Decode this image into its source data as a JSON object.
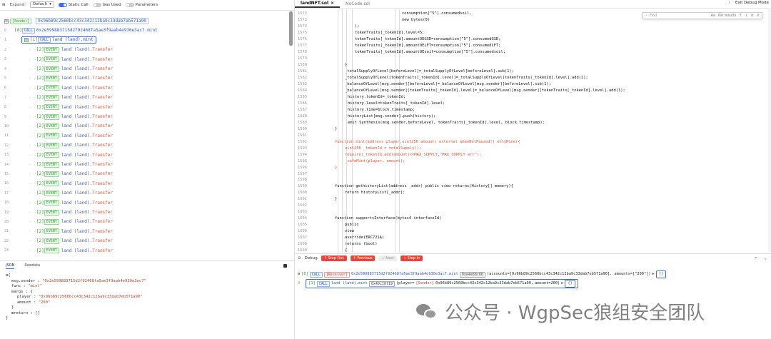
{
  "toolbar": {
    "expand_label": "Expand:",
    "expand_value": "Default",
    "static_call": "Static Call",
    "gas_used": "Gas Used",
    "parameters": "Parameters"
  },
  "trace": {
    "sender_chip": "[Sender]",
    "sender_addr": "0x96b89c2560bcc43c342c12ba9c33dab7eb571a90",
    "root_level": "[0]",
    "root_chip": "CALL",
    "root_addr": "0x2e599883715d2f92468fa5ae3f9aab4e930e3ac7.mint",
    "mint_level": "[1]",
    "mint_chip": "CALL",
    "mint_label": "land (land).mint",
    "event_level": "[2]",
    "event_chip": "EVENT",
    "event_name": "land (land).",
    "event_fn": "Transfer",
    "line_numbers": [
      "0",
      "1",
      "2",
      "3",
      "4",
      "5",
      "6",
      "7",
      "8",
      "9",
      "10",
      "11",
      "12",
      "13",
      "14",
      "15",
      "16",
      "17",
      "18",
      "19",
      "20",
      "21",
      "22",
      "23"
    ]
  },
  "bottom_left": {
    "tab_json": "JSON",
    "tab_raw": "Rawdata",
    "msg_sender_key": "msg.sender :",
    "msg_sender_val": "\"0x2e599883715d2f92468fa5ae3f9aab4e930e3ac7\"",
    "func_key": "func :",
    "func_val": "\"mint\"",
    "args_key": "args : {",
    "player_key": "player :",
    "player_val": "\"0x96b89c2560bcc43c342c12ba9c33dab7eb571a90\"",
    "amount_key": "amount :",
    "amount_val": "\"200\"",
    "close_args": "}",
    "return_key": "return :",
    "return_val": "[]",
    "open_brace": "{",
    "close_brace": "}"
  },
  "editor": {
    "tab_active": "landNFT.sol",
    "tab_other": "NoCode.sol",
    "exit_debug": "Exit Debug Mode",
    "find_placeholder": "Find",
    "find_results": "No results",
    "lines": [
      {
        "n": "1572",
        "t": "consumption[\"5\"].consumedsoil,"
      },
      {
        "n": "1573",
        "t": "new bytes(0)"
      },
      {
        "n": "1574",
        "t": ");"
      },
      {
        "n": "1575",
        "t": "tokenTraits[_tokenId].level=5;"
      },
      {
        "n": "1576",
        "t": "tokenTraits[_tokenId].amountOEGSD=consumption[\"5\"].consumedGSD;"
      },
      {
        "n": "1577",
        "t": "tokenTraits[_tokenId].amountOELFT=consumption[\"5\"].consumedLFT;"
      },
      {
        "n": "1578",
        "t": "tokenTraits[_tokenId].amountOEsoil=consumption[\"5\"].consumedsoil;"
      },
      {
        "n": "1579",
        "t": ""
      },
      {
        "n": "1580",
        "t": "}"
      },
      {
        "n": "1581",
        "t": "_totalSupplyOfLevel[beforeLevel]=_totalSupplyOfLevel[beforeLevel].sub(1);"
      },
      {
        "n": "1582",
        "t": "_totalSupplyOfLevel[tokenTraits[_tokenId].level]=_totalSupplyOfLevel[tokenTraits[_tokenId].level].add(1);"
      },
      {
        "n": "1583",
        "t": "_balanceOfLevel[msg.sender][beforeLevel]=_balanceOfLevel[msg.sender][beforeLevel].sub(1);"
      },
      {
        "n": "1584",
        "t": "_balanceOfLevel[msg.sender][tokenTraits[_tokenId].level]=_balanceOfLevel[msg.sender][tokenTraits[_tokenId].level].add(1);"
      },
      {
        "n": "1585",
        "t": "history.tokenId=_tokenId;"
      },
      {
        "n": "1586",
        "t": "history.level=tokenTraits[_tokenId].level;"
      },
      {
        "n": "1587",
        "t": "history.time=block.timestamp;"
      },
      {
        "n": "1588",
        "t": "historyList[msg.sender].push(history);"
      },
      {
        "n": "1589",
        "t": "emit Synthesis(msg.sender,beforeLevel, tokenTraits[_tokenId].level, block.timestamp);"
      },
      {
        "n": "1590",
        "t": "}"
      },
      {
        "n": "1591",
        "t": ""
      },
      {
        "n": "1592",
        "t": "function mint(address player,uint256 amount) external whenNotPaused() onlyMiner{"
      },
      {
        "n": "1593",
        "t": "uint256 _tokenId = totalSupply();"
      },
      {
        "n": "1594",
        "t": "require(_tokenId.add(amount)<=MAX_SUPPLY,\"MAX_SUPPLY err\");"
      },
      {
        "n": "1595",
        "t": "_safeMint(player, amount);"
      },
      {
        "n": "1596",
        "t": "}"
      },
      {
        "n": "1597",
        "t": ""
      },
      {
        "n": "1598",
        "t": ""
      },
      {
        "n": "1599",
        "t": "function gethistoryList(address _addr) public view returns(History[] memory){"
      },
      {
        "n": "1600",
        "t": "return historyList[_addr];"
      },
      {
        "n": "1601",
        "t": "}"
      },
      {
        "n": "1602",
        "t": ""
      },
      {
        "n": "1603",
        "t": ""
      },
      {
        "n": "1604",
        "t": "function supportsInterface(bytes4 interfaceId)"
      },
      {
        "n": "1605",
        "t": "public"
      },
      {
        "n": "1606",
        "t": "view"
      },
      {
        "n": "1607",
        "t": "override(ERC721A)"
      },
      {
        "n": "1608",
        "t": "returns (bool)"
      },
      {
        "n": "1609",
        "t": "{"
      }
    ]
  },
  "debug": {
    "title": "Debug",
    "step_out": "Step Out",
    "previous": "Previous",
    "next": "Next",
    "step_in": "Step In",
    "row1_level": "[0]",
    "row1_chip": "CALL",
    "row1_receiver": "[Receiver]",
    "row1_addr": "0x2e599883715d2f92468fa5ae3f9aab4e930e3ac7.mint",
    "row1_chip2": "0xe4e68c66",
    "row1_args": "(accounts=[0x96b89c2560bcc43c342c12ba9c33dab7eb571a90], amounts=[\"200\"])",
    "row1_paren": "()",
    "row2_ln": "0",
    "row2_level": "[1]",
    "row2_chip": "CALL",
    "row2_label": "land (land).mint",
    "row2_chip2": "0x40c10f19",
    "row2_args_k1": "(player=",
    "row2_sender": "[Sender]",
    "row2_addr": "0x96b89c2560bcc43c342c12ba9c33dab7eb571a90,",
    "row2_args_k2": "amount=200)",
    "row2_paren": "()"
  },
  "watermark": {
    "text": "公众号 · WgpSec狼组安全团队"
  }
}
